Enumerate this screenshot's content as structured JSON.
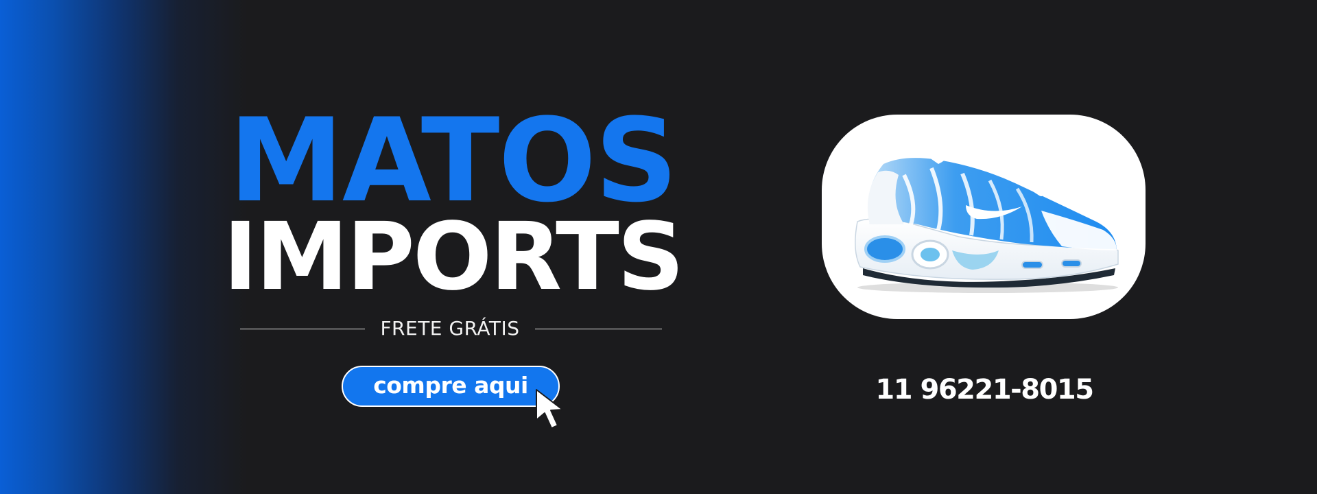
{
  "brand": {
    "line1": "MATOS",
    "line2": "IMPORTS"
  },
  "tagline": "FRETE GRÁTIS",
  "cta": {
    "label": "compre aqui"
  },
  "contact": {
    "phone": "11 96221-8015"
  },
  "icons": {
    "cursor": "pointer-cursor-icon",
    "product": "sneaker-image"
  },
  "colors": {
    "background": "#1b1b1d",
    "accent": "#1476ee",
    "text": "#ffffff"
  }
}
